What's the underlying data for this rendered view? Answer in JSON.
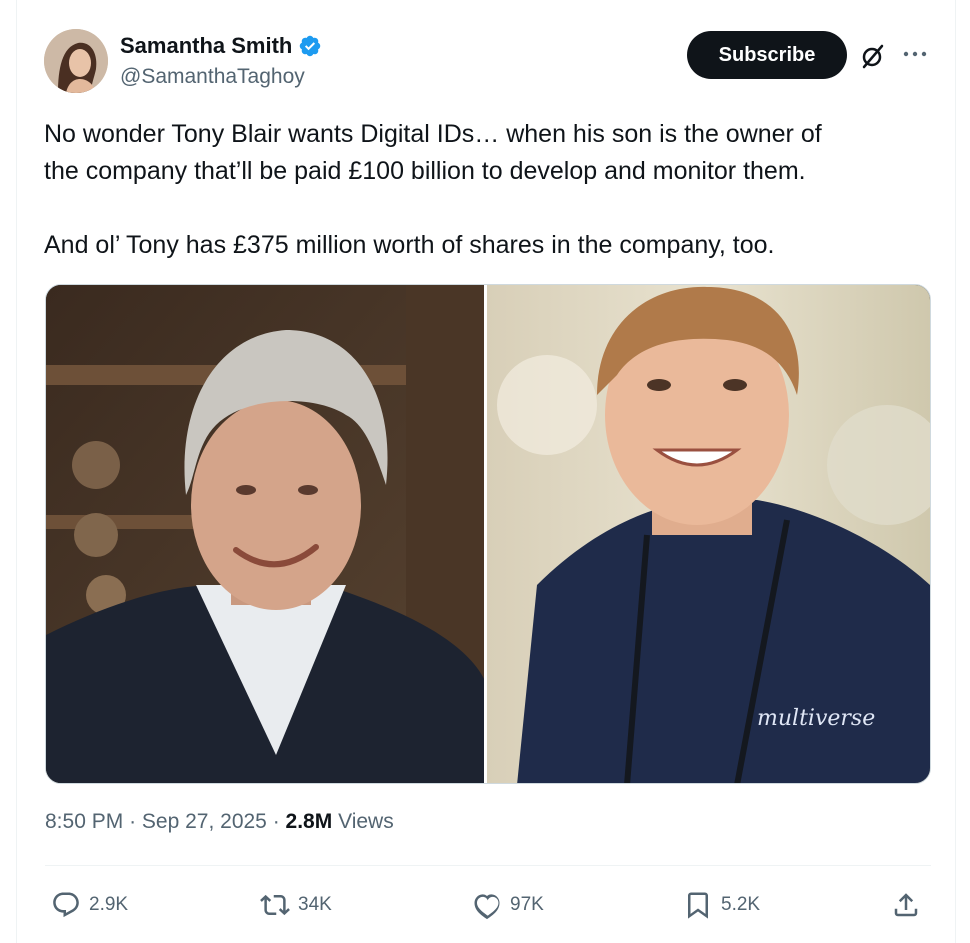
{
  "author": {
    "display_name": "Samantha Smith",
    "handle": "@SamanthaTaghoy",
    "verified": true,
    "verified_color": "#1d9bf0"
  },
  "header": {
    "subscribe_label": "Subscribe",
    "icons": [
      "grok-icon",
      "more-icon"
    ]
  },
  "tweet": {
    "text": "No wonder Tony Blair wants Digital IDs… when his son is the owner of\nthe company that’ll be paid £100 billion to develop and monitor them.\n\nAnd ol’ Tony has £375 million worth of shares in the company, too.",
    "media": [
      {
        "description": "photo-left"
      },
      {
        "description": "photo-right",
        "sweater_text": "multiverse"
      }
    ]
  },
  "meta": {
    "time": "8:50 PM",
    "separator": "·",
    "date": "Sep 27, 2025",
    "views_count": "2.8M",
    "views_label": "Views"
  },
  "actions": {
    "replies": "2.9K",
    "reposts": "34K",
    "likes": "97K",
    "bookmarks": "5.2K"
  }
}
